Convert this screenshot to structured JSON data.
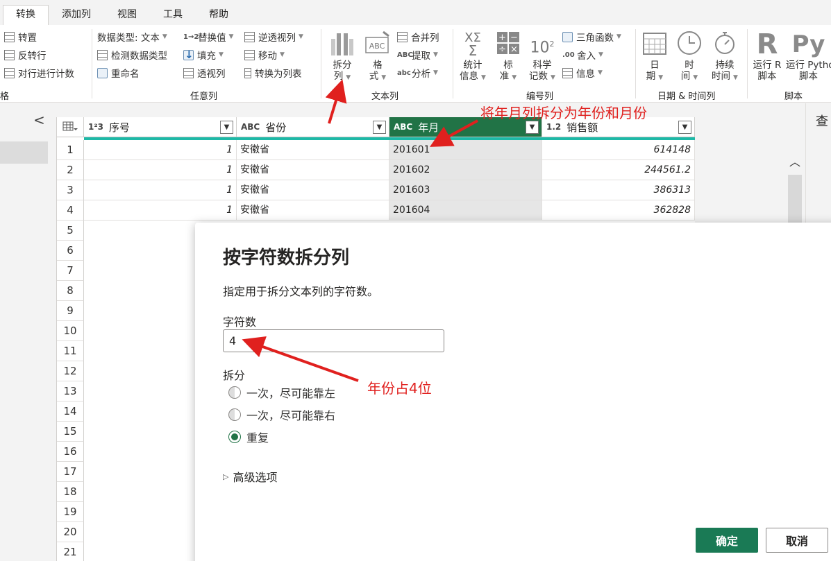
{
  "tabs": [
    "转换",
    "添加列",
    "视图",
    "工具",
    "帮助"
  ],
  "ribbon": {
    "table_group": {
      "label": "格",
      "items": [
        "转置",
        "反转行",
        "对行进行计数"
      ]
    },
    "any_column": {
      "label": "任意列",
      "datatype": "数据类型: 文本",
      "detect": "检测数据类型",
      "rename": "重命名",
      "replace": "替换值",
      "fill": "填充",
      "pivot": "透视列",
      "unpivot": "逆透视列",
      "move": "移动",
      "to_list": "转换为列表"
    },
    "text_column": {
      "label": "文本列",
      "split_l1": "拆分",
      "split_l2": "列",
      "format_l1": "格",
      "format_l2": "式",
      "merge": "合并列",
      "extract": "提取",
      "parse": "分析"
    },
    "number_column": {
      "label": "编号列",
      "stats_l1": "统计",
      "stats_l2": "信息",
      "std_l1": "标",
      "std_l2": "准",
      "sci_l1": "科学",
      "sci_l2": "记数",
      "sci_glyph": "10",
      "trig": "三角函数",
      "round": "舍入",
      "info": "信息"
    },
    "datetime": {
      "label": "日期 & 时间列",
      "date_l1": "日",
      "date_l2": "期",
      "time_l1": "时",
      "time_l2": "间",
      "dur_l1": "持续",
      "dur_l2": "时间"
    },
    "script": {
      "label": "脚本",
      "r_l1": "运行 R",
      "r_l2": "脚本",
      "py_l1": "运行 Python",
      "py_l2": "脚本",
      "r_glyph": "R",
      "py_glyph": "Py"
    }
  },
  "grid": {
    "columns": [
      {
        "type": "1²3",
        "name": "序号"
      },
      {
        "type": "ABC",
        "name": "省份"
      },
      {
        "type": "ABC",
        "name": "年月"
      },
      {
        "type": "1.2",
        "name": "销售额"
      }
    ],
    "row_numbers": [
      "1",
      "2",
      "3",
      "4",
      "5",
      "6",
      "7",
      "8",
      "9",
      "10",
      "11",
      "12",
      "13",
      "14",
      "15",
      "16",
      "17",
      "18",
      "19",
      "20",
      "21"
    ],
    "rows": [
      [
        "1",
        "安徽省",
        "201601",
        "614148"
      ],
      [
        "1",
        "安徽省",
        "201602",
        "244561.2"
      ],
      [
        "1",
        "安徽省",
        "201603",
        "386313"
      ],
      [
        "1",
        "安徽省",
        "201604",
        "362828"
      ]
    ]
  },
  "right_pane": {
    "title": "查"
  },
  "dialog": {
    "title": "按字符数拆分列",
    "description": "指定用于拆分文本列的字符数。",
    "char_count_label": "字符数",
    "char_count_value": "4",
    "split_label": "拆分",
    "options": [
      "一次，尽可能靠左",
      "一次，尽可能靠右",
      "重复"
    ],
    "selected_option": "重复",
    "advanced": "高级选项",
    "ok": "确定",
    "cancel": "取消"
  },
  "annotations": {
    "top": "将年月列拆分为年份和月份",
    "mid": "年份占4位",
    "color": "#e0201e"
  }
}
